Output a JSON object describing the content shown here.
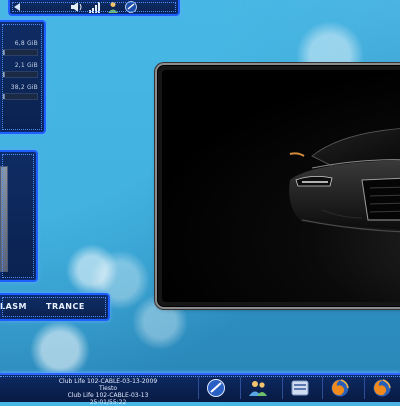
{
  "tray": {
    "icons": [
      "speaker-icon",
      "signal-bars-icon",
      "user-icon",
      "app-orb-icon"
    ]
  },
  "drives": [
    {
      "size": "6,8 GiB",
      "used_fraction": 0.05
    },
    {
      "size": "2,1 GiB",
      "used_fraction": 0.06
    },
    {
      "size": "38,2 GiB",
      "used_fraction": 0.05
    }
  ],
  "genres": [
    "LASM",
    "TRANCE"
  ],
  "now_playing": {
    "line1": "Club Life 102-CABLE-03-13-2009",
    "line2": "Tiesto",
    "line3": "Club Life 102-CABLE-03-13",
    "line4": "25:01/55:22"
  },
  "taskbar": {
    "buttons": [
      "app-orb-icon",
      "users-icon",
      "window-icon",
      "firefox-icon",
      "firefox-icon"
    ]
  }
}
